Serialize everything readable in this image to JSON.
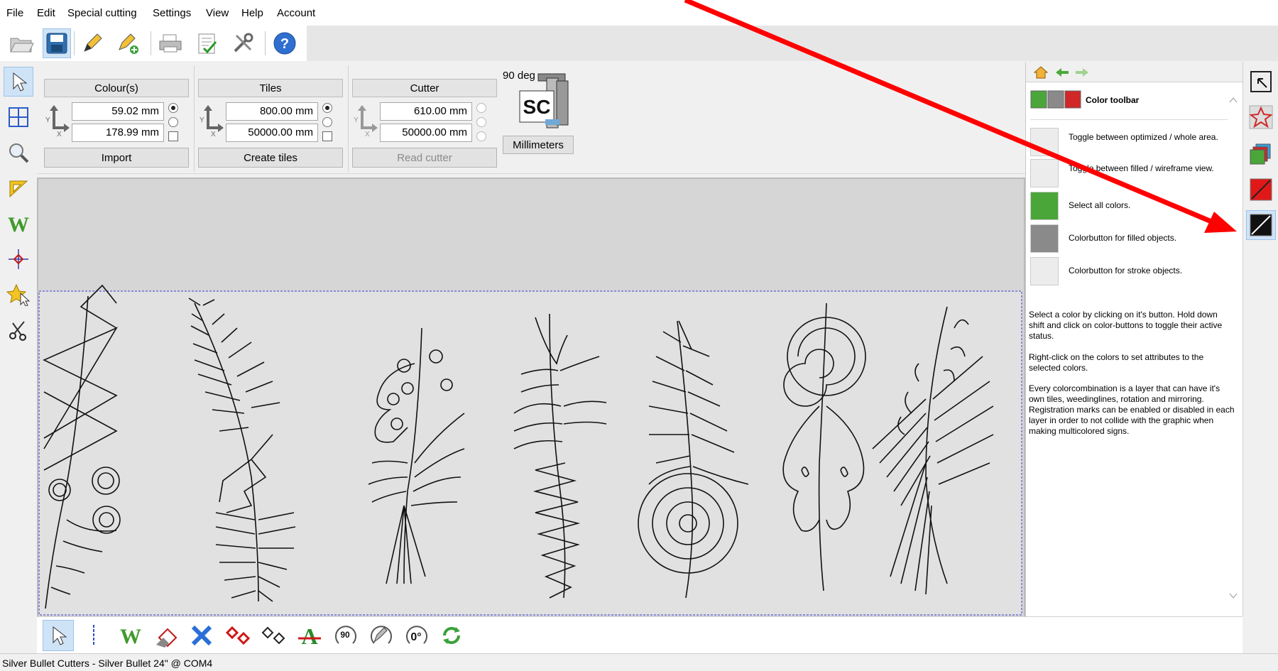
{
  "menu": [
    "File",
    "Edit",
    "Special cutting",
    "Settings",
    "View",
    "Help",
    "Account"
  ],
  "toolbar": {
    "icons": [
      "open-icon",
      "save-icon",
      "pencil-icon",
      "pencil-add-icon",
      "print-icon",
      "checklist-icon",
      "tools-icon",
      "help-icon"
    ]
  },
  "left_tools": [
    "select-arrow-icon",
    "tiles-grid-icon",
    "zoom-icon",
    "corner-icon",
    "weeding-w-icon",
    "registration-mark-icon",
    "star-select-icon",
    "scissors-icon"
  ],
  "colours_group": {
    "header": "Colour(s)",
    "x_value": "59.02 mm",
    "y_value": "178.99 mm",
    "button": "Import"
  },
  "tiles_group": {
    "header": "Tiles",
    "x_value": "800.00 mm",
    "y_value": "50000.00 mm",
    "button": "Create tiles"
  },
  "cutter_group": {
    "header": "Cutter",
    "x_value": "610.00 mm",
    "y_value": "50000.00 mm",
    "button": "Read cutter"
  },
  "rotation": {
    "label": "90 deg",
    "logo_text": "SC",
    "units_button": "Millimeters"
  },
  "axis_labels": {
    "x": "X",
    "y": "Y"
  },
  "help": {
    "title": "Color toolbar",
    "rows": [
      "Toggle between optimized / whole area.",
      "Toggle between filled / wireframe view.",
      "Select all colors.",
      "Colorbutton for filled objects.",
      "Colorbutton for stroke objects."
    ],
    "paragraphs": [
      "Select a color by clicking on it's button. Hold down shift and click on color-buttons to toggle their active status.",
      "Right-click on the colors to set attributes to the selected colors.",
      "Every colorcombination is a layer that can have it's own tiles, weedinglines, rotation and mirroring. Registration marks can be enabled or disabled in each layer in order to not collide with the graphic when making multicolored signs."
    ]
  },
  "bottom_tools": {
    "rotate_90_label": "90",
    "rotate_0_label": "0°",
    "text_tool_label": "A",
    "weeding_label": "W"
  },
  "status": "Silver Bullet Cutters - Silver Bullet 24\" @ COM4",
  "colors": {
    "annotation_arrow": "#ff0000",
    "selection_blue": "#cfe3f7"
  }
}
